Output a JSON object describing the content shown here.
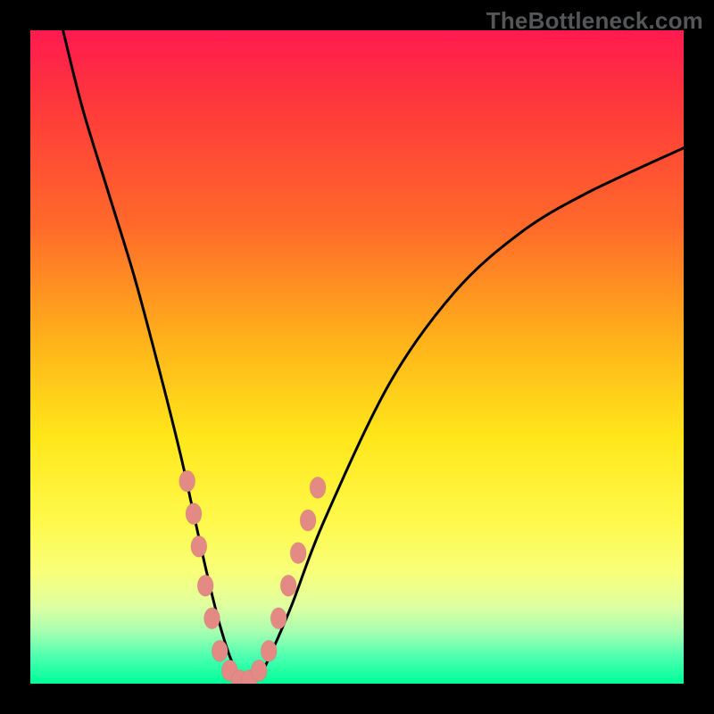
{
  "watermark": "TheBottleneck.com",
  "chart_data": {
    "type": "line",
    "title": "",
    "xlabel": "",
    "ylabel": "",
    "xlim": [
      0,
      100
    ],
    "ylim": [
      0,
      100
    ],
    "series": [
      {
        "name": "bottleneck-curve",
        "x": [
          5,
          8,
          12,
          16,
          20,
          23,
          25,
          27,
          29,
          31,
          33,
          35,
          37,
          40,
          45,
          55,
          65,
          75,
          85,
          100
        ],
        "y": [
          100,
          88,
          75,
          62,
          47,
          35,
          26,
          17,
          9,
          3,
          0,
          1,
          5,
          12,
          25,
          46,
          60,
          69,
          75,
          82
        ]
      }
    ],
    "markers": {
      "name": "cluster-beads",
      "points": [
        {
          "x": 24.0,
          "y": 31
        },
        {
          "x": 25.0,
          "y": 26
        },
        {
          "x": 25.8,
          "y": 21
        },
        {
          "x": 26.8,
          "y": 15
        },
        {
          "x": 27.8,
          "y": 10
        },
        {
          "x": 29.0,
          "y": 5
        },
        {
          "x": 30.5,
          "y": 2
        },
        {
          "x": 32.0,
          "y": 0.5
        },
        {
          "x": 33.5,
          "y": 0.5
        },
        {
          "x": 35.0,
          "y": 2
        },
        {
          "x": 36.5,
          "y": 5
        },
        {
          "x": 38.0,
          "y": 10
        },
        {
          "x": 39.5,
          "y": 15
        },
        {
          "x": 41.0,
          "y": 20
        },
        {
          "x": 42.5,
          "y": 25
        },
        {
          "x": 44.0,
          "y": 30
        }
      ]
    },
    "colors": {
      "curve": "#000000",
      "bead": "#e48a85",
      "gradient_top": "#ff1a4f",
      "gradient_bottom": "#00ff99"
    }
  }
}
